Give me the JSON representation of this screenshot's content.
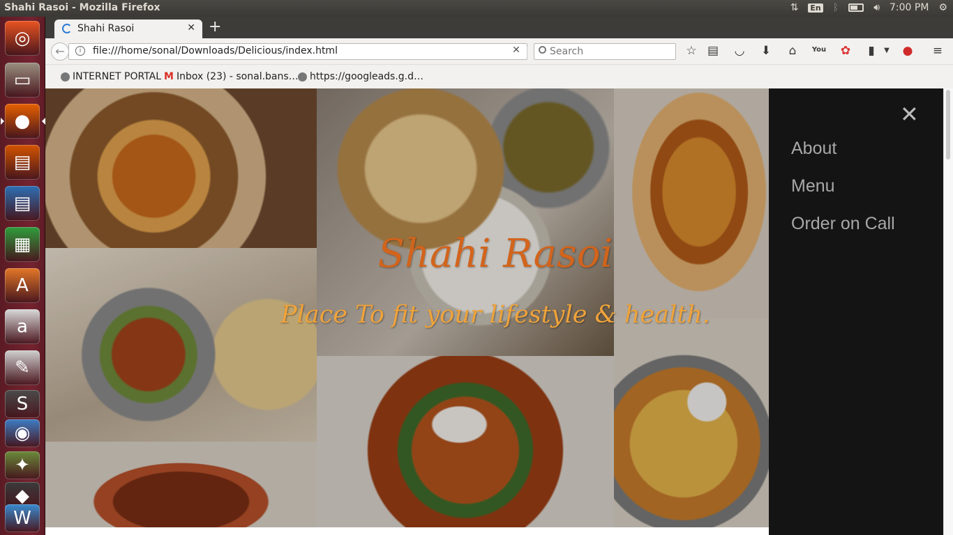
{
  "window": {
    "title": "Shahi Rasoi - Mozilla Firefox"
  },
  "panel": {
    "keyboard": "En",
    "time": "7:00 PM"
  },
  "launcher": {
    "items": [
      {
        "name": "ubuntu-dash-icon",
        "color": "#e95420",
        "glyph": "◎"
      },
      {
        "name": "files-icon",
        "color": "#9a8f80",
        "glyph": "▭"
      },
      {
        "name": "firefox-icon",
        "color": "#e66000",
        "glyph": "●"
      },
      {
        "name": "impress-icon",
        "color": "#d35400",
        "glyph": "▤"
      },
      {
        "name": "writer-icon",
        "color": "#2c6fb4",
        "glyph": "▤"
      },
      {
        "name": "calc-icon",
        "color": "#2f9d3c",
        "glyph": "▦"
      },
      {
        "name": "software-center-icon",
        "color": "#e37728",
        "glyph": "A"
      },
      {
        "name": "amazon-icon",
        "color": "#d9d9d9",
        "glyph": "a"
      },
      {
        "name": "text-editor-icon",
        "color": "#cfcfcf",
        "glyph": "✎"
      },
      {
        "name": "sublime-icon",
        "color": "#4a4a4a",
        "glyph": "S"
      },
      {
        "name": "disk-icon",
        "color": "#3d7cc4",
        "glyph": "◉"
      },
      {
        "name": "xfig-icon",
        "color": "#6a8a3a",
        "glyph": "✦"
      },
      {
        "name": "app-icon",
        "color": "#3a3a3a",
        "glyph": "◆"
      },
      {
        "name": "wordpress-icon",
        "color": "#3a8bd0",
        "glyph": "W"
      }
    ]
  },
  "browser": {
    "tab_title": "Shahi Rasoi",
    "url": "file:///home/sonal/Downloads/Delicious/index.html",
    "search_placeholder": "Search",
    "bookmarks": [
      {
        "label": "INTERNET PORTAL"
      },
      {
        "label": "Inbox (23) - sonal.bans…"
      },
      {
        "label": "https://googleads.g.d…"
      }
    ]
  },
  "hero": {
    "title": "Shahi Rasoi",
    "subtitle": "Place To fit your lifestyle & health."
  },
  "menu": {
    "close": "✕",
    "items": [
      "About",
      "Menu",
      "Order on Call"
    ]
  }
}
